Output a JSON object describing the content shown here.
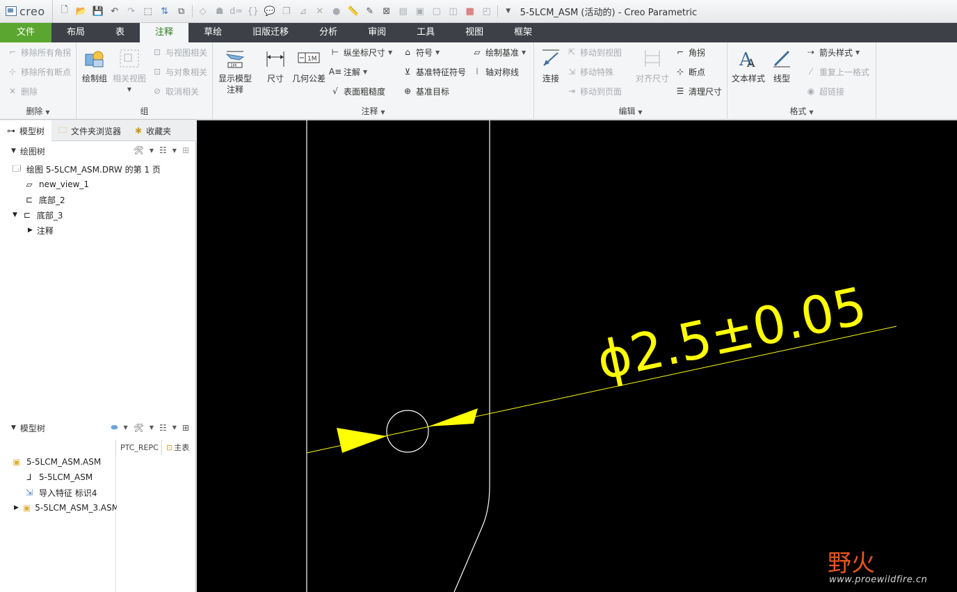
{
  "app": {
    "logo": "creo",
    "title": "5-5LCM_ASM (活动的) - Creo Parametric"
  },
  "tabs": [
    "文件",
    "布局",
    "表",
    "注释",
    "草绘",
    "旧版迁移",
    "分析",
    "审阅",
    "工具",
    "视图",
    "框架"
  ],
  "ribbon": {
    "delete_group": {
      "label": "删除",
      "items": [
        "移除所有角拐",
        "移除所有断点",
        "删除"
      ]
    },
    "group_group": {
      "label": "组",
      "draw_group": "绘制组",
      "related_view": "相关视图",
      "items": [
        "与视图相关",
        "与对象相关",
        "取消相关"
      ]
    },
    "annotate_group": {
      "label": "注释",
      "show_model": "显示模型\n注释",
      "dimension": "尺寸",
      "gtol": "几何公差",
      "col1": [
        "纵坐标尺寸",
        "注解",
        "表面粗糙度"
      ],
      "col2": [
        "符号",
        "基准特征符号",
        "基准目标"
      ],
      "col3": [
        "绘制基准",
        "轴对称线"
      ]
    },
    "edit_group": {
      "label": "编辑",
      "connect": "连接",
      "align": "对齐尺寸",
      "col1": [
        "移动到视图",
        "移动特殊",
        "移动到页面"
      ],
      "col2": [
        "角拐",
        "断点",
        "清理尺寸"
      ]
    },
    "format_group": {
      "label": "格式",
      "text_style": "文本样式",
      "line_style": "线型",
      "items": [
        "箭头样式",
        "重复上一格式",
        "超链接"
      ]
    }
  },
  "panel": {
    "tabs": [
      "模型树",
      "文件夹浏览器",
      "收藏夹"
    ],
    "drawing_tree": {
      "title": "绘图树",
      "root": "绘图 5-5LCM_ASM.DRW 的第 1 页",
      "items": [
        "new_view_1",
        "底部_2",
        "底部_3",
        "注释"
      ]
    },
    "model_tree": {
      "title": "模型树",
      "columns": [
        "PTC_REPC",
        "主表"
      ],
      "items": [
        "5-5LCM_ASM.ASM",
        "5-5LCM_ASM",
        "导入特征 标识4",
        "5-5LCM_ASM_3.ASM"
      ]
    }
  },
  "canvas": {
    "dimension_text": "ϕ2.5±0.05",
    "dimension_color": "#ffff00",
    "background": "#000000"
  },
  "watermark": {
    "cn": "野火",
    "url": "www.proewildfire.cn"
  }
}
